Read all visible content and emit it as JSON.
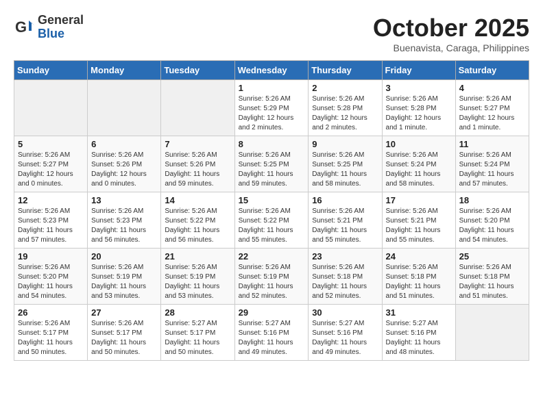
{
  "logo": {
    "general": "General",
    "blue": "Blue"
  },
  "title": "October 2025",
  "subtitle": "Buenavista, Caraga, Philippines",
  "days_of_week": [
    "Sunday",
    "Monday",
    "Tuesday",
    "Wednesday",
    "Thursday",
    "Friday",
    "Saturday"
  ],
  "weeks": [
    [
      {
        "day": "",
        "info": ""
      },
      {
        "day": "",
        "info": ""
      },
      {
        "day": "",
        "info": ""
      },
      {
        "day": "1",
        "info": "Sunrise: 5:26 AM\nSunset: 5:29 PM\nDaylight: 12 hours and 2 minutes."
      },
      {
        "day": "2",
        "info": "Sunrise: 5:26 AM\nSunset: 5:28 PM\nDaylight: 12 hours and 2 minutes."
      },
      {
        "day": "3",
        "info": "Sunrise: 5:26 AM\nSunset: 5:28 PM\nDaylight: 12 hours and 1 minute."
      },
      {
        "day": "4",
        "info": "Sunrise: 5:26 AM\nSunset: 5:27 PM\nDaylight: 12 hours and 1 minute."
      }
    ],
    [
      {
        "day": "5",
        "info": "Sunrise: 5:26 AM\nSunset: 5:27 PM\nDaylight: 12 hours and 0 minutes."
      },
      {
        "day": "6",
        "info": "Sunrise: 5:26 AM\nSunset: 5:26 PM\nDaylight: 12 hours and 0 minutes."
      },
      {
        "day": "7",
        "info": "Sunrise: 5:26 AM\nSunset: 5:26 PM\nDaylight: 11 hours and 59 minutes."
      },
      {
        "day": "8",
        "info": "Sunrise: 5:26 AM\nSunset: 5:25 PM\nDaylight: 11 hours and 59 minutes."
      },
      {
        "day": "9",
        "info": "Sunrise: 5:26 AM\nSunset: 5:25 PM\nDaylight: 11 hours and 58 minutes."
      },
      {
        "day": "10",
        "info": "Sunrise: 5:26 AM\nSunset: 5:24 PM\nDaylight: 11 hours and 58 minutes."
      },
      {
        "day": "11",
        "info": "Sunrise: 5:26 AM\nSunset: 5:24 PM\nDaylight: 11 hours and 57 minutes."
      }
    ],
    [
      {
        "day": "12",
        "info": "Sunrise: 5:26 AM\nSunset: 5:23 PM\nDaylight: 11 hours and 57 minutes."
      },
      {
        "day": "13",
        "info": "Sunrise: 5:26 AM\nSunset: 5:23 PM\nDaylight: 11 hours and 56 minutes."
      },
      {
        "day": "14",
        "info": "Sunrise: 5:26 AM\nSunset: 5:22 PM\nDaylight: 11 hours and 56 minutes."
      },
      {
        "day": "15",
        "info": "Sunrise: 5:26 AM\nSunset: 5:22 PM\nDaylight: 11 hours and 55 minutes."
      },
      {
        "day": "16",
        "info": "Sunrise: 5:26 AM\nSunset: 5:21 PM\nDaylight: 11 hours and 55 minutes."
      },
      {
        "day": "17",
        "info": "Sunrise: 5:26 AM\nSunset: 5:21 PM\nDaylight: 11 hours and 55 minutes."
      },
      {
        "day": "18",
        "info": "Sunrise: 5:26 AM\nSunset: 5:20 PM\nDaylight: 11 hours and 54 minutes."
      }
    ],
    [
      {
        "day": "19",
        "info": "Sunrise: 5:26 AM\nSunset: 5:20 PM\nDaylight: 11 hours and 54 minutes."
      },
      {
        "day": "20",
        "info": "Sunrise: 5:26 AM\nSunset: 5:19 PM\nDaylight: 11 hours and 53 minutes."
      },
      {
        "day": "21",
        "info": "Sunrise: 5:26 AM\nSunset: 5:19 PM\nDaylight: 11 hours and 53 minutes."
      },
      {
        "day": "22",
        "info": "Sunrise: 5:26 AM\nSunset: 5:19 PM\nDaylight: 11 hours and 52 minutes."
      },
      {
        "day": "23",
        "info": "Sunrise: 5:26 AM\nSunset: 5:18 PM\nDaylight: 11 hours and 52 minutes."
      },
      {
        "day": "24",
        "info": "Sunrise: 5:26 AM\nSunset: 5:18 PM\nDaylight: 11 hours and 51 minutes."
      },
      {
        "day": "25",
        "info": "Sunrise: 5:26 AM\nSunset: 5:18 PM\nDaylight: 11 hours and 51 minutes."
      }
    ],
    [
      {
        "day": "26",
        "info": "Sunrise: 5:26 AM\nSunset: 5:17 PM\nDaylight: 11 hours and 50 minutes."
      },
      {
        "day": "27",
        "info": "Sunrise: 5:26 AM\nSunset: 5:17 PM\nDaylight: 11 hours and 50 minutes."
      },
      {
        "day": "28",
        "info": "Sunrise: 5:27 AM\nSunset: 5:17 PM\nDaylight: 11 hours and 50 minutes."
      },
      {
        "day": "29",
        "info": "Sunrise: 5:27 AM\nSunset: 5:16 PM\nDaylight: 11 hours and 49 minutes."
      },
      {
        "day": "30",
        "info": "Sunrise: 5:27 AM\nSunset: 5:16 PM\nDaylight: 11 hours and 49 minutes."
      },
      {
        "day": "31",
        "info": "Sunrise: 5:27 AM\nSunset: 5:16 PM\nDaylight: 11 hours and 48 minutes."
      },
      {
        "day": "",
        "info": ""
      }
    ]
  ]
}
